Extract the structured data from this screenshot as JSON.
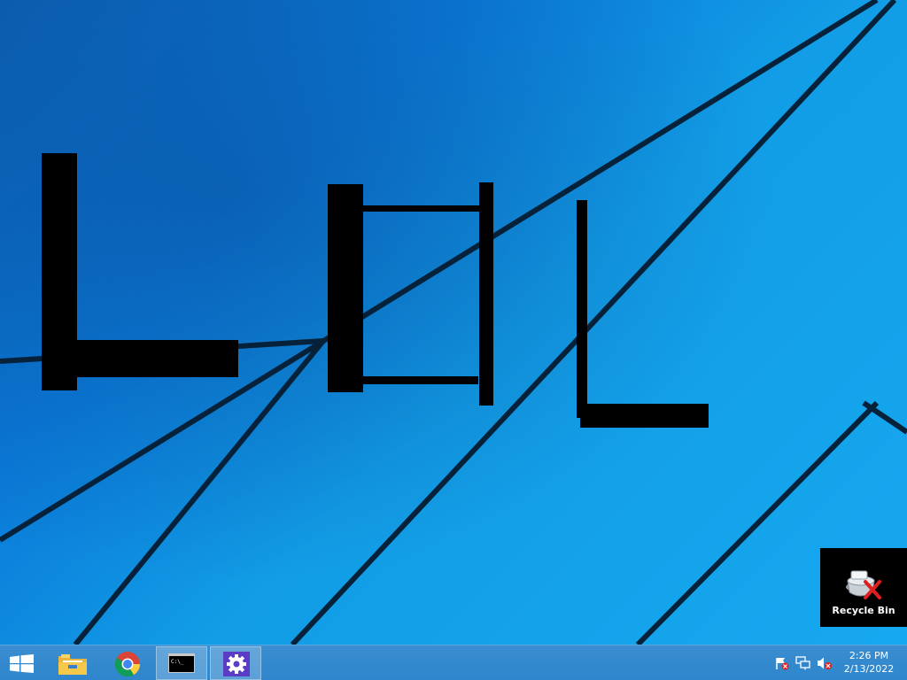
{
  "desktop": {
    "wallpaper": "windows-8-blue-lines",
    "background_colors": [
      "#0b5fb3",
      "#16a8f0"
    ],
    "drawing_color": "#000000",
    "icons": [
      {
        "label": "Recycle Bin",
        "icon": "recycle-bin-icon"
      }
    ]
  },
  "taskbar": {
    "color": "#2f86cc",
    "start": {
      "icon": "windows-logo-icon"
    },
    "pinned": [
      {
        "name": "File Explorer",
        "icon": "folder-icon",
        "active": false
      },
      {
        "name": "Google Chrome",
        "icon": "chrome-icon",
        "active": false
      },
      {
        "name": "Command Prompt",
        "icon": "cmd-icon",
        "active": true
      },
      {
        "name": "Settings",
        "icon": "gear-icon",
        "active": true
      }
    ],
    "tray": {
      "icons": [
        "action-center-flag-icon",
        "network-icon",
        "volume-muted-icon"
      ]
    },
    "clock": {
      "time": "2:26 PM",
      "date": "2/13/2022"
    }
  }
}
